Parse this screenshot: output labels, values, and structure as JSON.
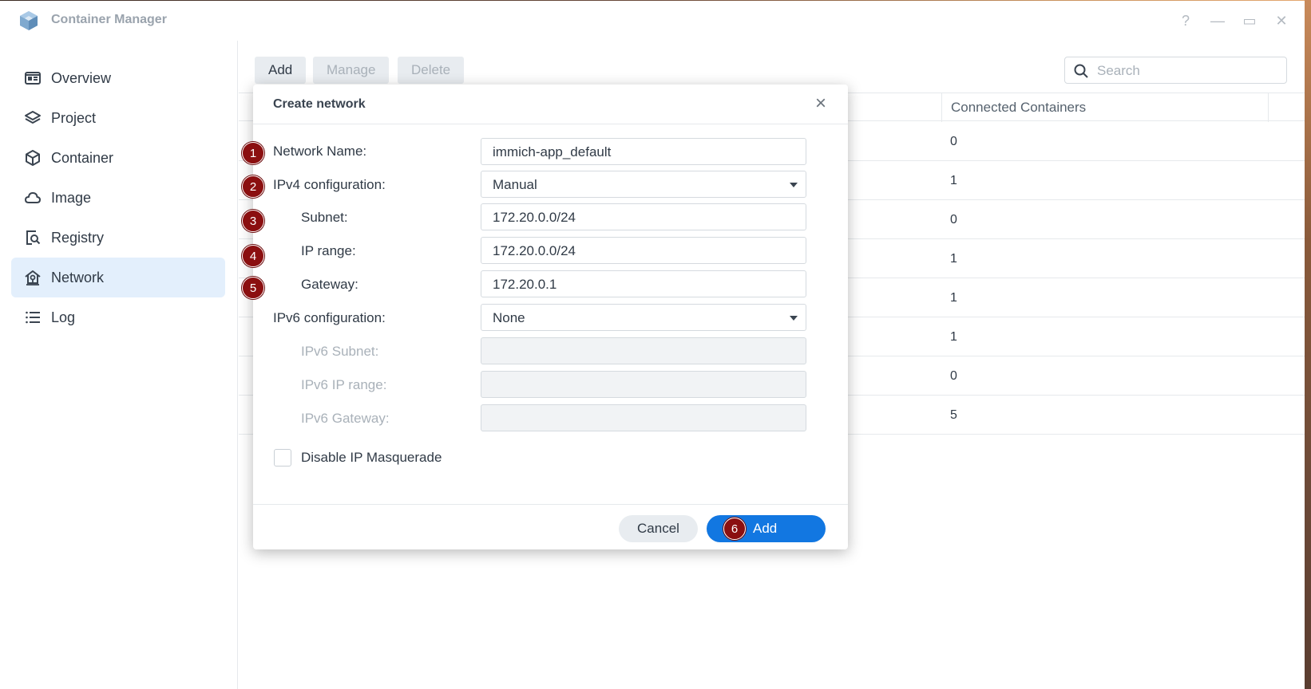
{
  "window": {
    "title": "Container Manager",
    "controls": [
      "?",
      "—",
      "▭",
      "✕"
    ]
  },
  "sidebar": {
    "items": [
      {
        "label": "Overview",
        "icon": "overview-icon",
        "active": false
      },
      {
        "label": "Project",
        "icon": "layers-icon",
        "active": false
      },
      {
        "label": "Container",
        "icon": "cube-icon",
        "active": false
      },
      {
        "label": "Image",
        "icon": "cloud-icon",
        "active": false
      },
      {
        "label": "Registry",
        "icon": "registry-search-icon",
        "active": false
      },
      {
        "label": "Network",
        "icon": "network-home-icon",
        "active": true
      },
      {
        "label": "Log",
        "icon": "list-icon",
        "active": false
      }
    ]
  },
  "toolbar": {
    "add_label": "Add",
    "manage_label": "Manage",
    "delete_label": "Delete",
    "search_placeholder": "Search"
  },
  "table": {
    "column_header": "Connected Containers",
    "rows": [
      "0",
      "1",
      "0",
      "1",
      "1",
      "1",
      "0",
      "5"
    ]
  },
  "dialog": {
    "title": "Create network",
    "fields": {
      "network_name": {
        "label": "Network Name:",
        "value": "immich-app_default"
      },
      "ipv4_config": {
        "label": "IPv4 configuration:",
        "value": "Manual"
      },
      "subnet": {
        "label": "Subnet:",
        "value": "172.20.0.0/24"
      },
      "ip_range": {
        "label": "IP range:",
        "value": "172.20.0.0/24"
      },
      "gateway": {
        "label": "Gateway:",
        "value": "172.20.0.1"
      },
      "ipv6_config": {
        "label": "IPv6 configuration:",
        "value": "None"
      },
      "ipv6_subnet": {
        "label": "IPv6 Subnet:",
        "value": ""
      },
      "ipv6_ip_range": {
        "label": "IPv6 IP range:",
        "value": ""
      },
      "ipv6_gateway": {
        "label": "IPv6 Gateway:",
        "value": ""
      }
    },
    "masquerade_label": "Disable IP Masquerade",
    "cancel_label": "Cancel",
    "add_label": "Add"
  },
  "annotations": [
    "1",
    "2",
    "3",
    "4",
    "5",
    "6"
  ],
  "colors": {
    "accent": "#1277e1",
    "badge": "#8b0f10",
    "active_nav": "#e3effc"
  }
}
